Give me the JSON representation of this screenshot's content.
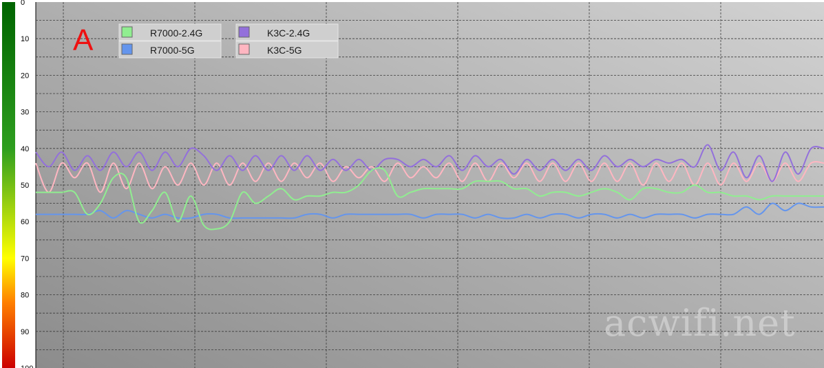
{
  "panel_label": "A",
  "watermark": "acwifi.net",
  "colors": {
    "scale_top": "#006400",
    "scale_mid_green": "#2e9e1f",
    "scale_yellow": "#ffff00",
    "scale_orange": "#ff8000",
    "scale_bottom": "#cc0000",
    "plot_bg_top_right": "#d2d2d2",
    "plot_bg_bottom_left": "#8c8c8c",
    "grid": "#3a3a3a"
  },
  "chart_data": {
    "type": "line",
    "title": "",
    "xlabel": "",
    "ylabel": "",
    "ylim": [
      0,
      100
    ],
    "y_inverted": true,
    "y_ticks": [
      "0",
      "10",
      "20",
      "30",
      "40",
      "50",
      "60",
      "70",
      "80",
      "90",
      "100"
    ],
    "grid": true,
    "legend_position": "top-left",
    "x": [
      0,
      1,
      2,
      3,
      4,
      5,
      6,
      7,
      8,
      9,
      10,
      11,
      12,
      13,
      14,
      15,
      16,
      17,
      18,
      19,
      20,
      21,
      22,
      23,
      24,
      25,
      26,
      27,
      28,
      29,
      30,
      31,
      32,
      33,
      34,
      35,
      36,
      37,
      38,
      39,
      40,
      41,
      42,
      43,
      44,
      45,
      46,
      47,
      48,
      49,
      50,
      51,
      52,
      53,
      54,
      55,
      56,
      57,
      58,
      59,
      60,
      61
    ],
    "series": [
      {
        "name": "R7000-2.4G",
        "color": "#90ee90",
        "values": [
          52,
          52,
          52,
          52,
          58,
          55,
          48,
          48,
          60,
          57,
          52,
          60,
          53,
          61,
          62,
          60,
          52,
          55,
          53,
          51,
          54,
          53,
          53,
          52,
          52,
          50,
          46,
          46,
          53,
          52,
          51,
          51,
          51,
          51,
          49,
          49,
          49,
          51,
          51,
          53,
          52,
          52,
          53,
          52,
          51,
          52,
          54,
          51,
          51,
          52,
          52,
          50,
          52,
          52,
          53,
          53,
          54,
          53,
          53,
          53,
          53,
          53
        ]
      },
      {
        "name": "R7000-5G",
        "color": "#6495ed",
        "values": [
          58,
          58,
          58,
          58,
          58,
          57,
          59,
          57,
          58,
          59,
          58,
          59,
          59,
          58,
          58,
          59,
          59,
          59,
          59,
          59,
          59,
          58,
          58,
          59,
          58,
          58,
          58,
          58,
          58,
          58,
          59,
          58,
          58,
          58,
          59,
          58,
          59,
          59,
          58,
          59,
          58,
          58,
          59,
          58,
          58,
          59,
          58,
          59,
          58,
          58,
          58,
          59,
          58,
          58,
          58,
          56,
          58,
          55,
          57,
          55,
          56,
          56
        ]
      },
      {
        "name": "K3C-2.4G",
        "color": "#9370db",
        "values": [
          41,
          45,
          41,
          46,
          42,
          46,
          41,
          45,
          41,
          46,
          41,
          45,
          40,
          42,
          46,
          42,
          46,
          42,
          46,
          42,
          46,
          42,
          46,
          43,
          46,
          43,
          46,
          43,
          43,
          45,
          43,
          45,
          42,
          46,
          42,
          45,
          43,
          47,
          43,
          46,
          43,
          46,
          43,
          46,
          42,
          45,
          43,
          45,
          43,
          44,
          43,
          45,
          39,
          46,
          41,
          48,
          42,
          49,
          41,
          47,
          40,
          40
        ]
      },
      {
        "name": "K3C-5G",
        "color": "#ffb6c1",
        "values": [
          44,
          52,
          44,
          48,
          44,
          52,
          44,
          51,
          44,
          51,
          45,
          50,
          44,
          50,
          44,
          50,
          44,
          49,
          44,
          49,
          44,
          48,
          44,
          49,
          45,
          48,
          45,
          49,
          44,
          48,
          45,
          48,
          44,
          49,
          44,
          49,
          44,
          48,
          44,
          49,
          44,
          49,
          44,
          49,
          44,
          49,
          44,
          50,
          44,
          49,
          44,
          50,
          44,
          50,
          44,
          49,
          44,
          49,
          44,
          49,
          44,
          44
        ]
      }
    ]
  }
}
